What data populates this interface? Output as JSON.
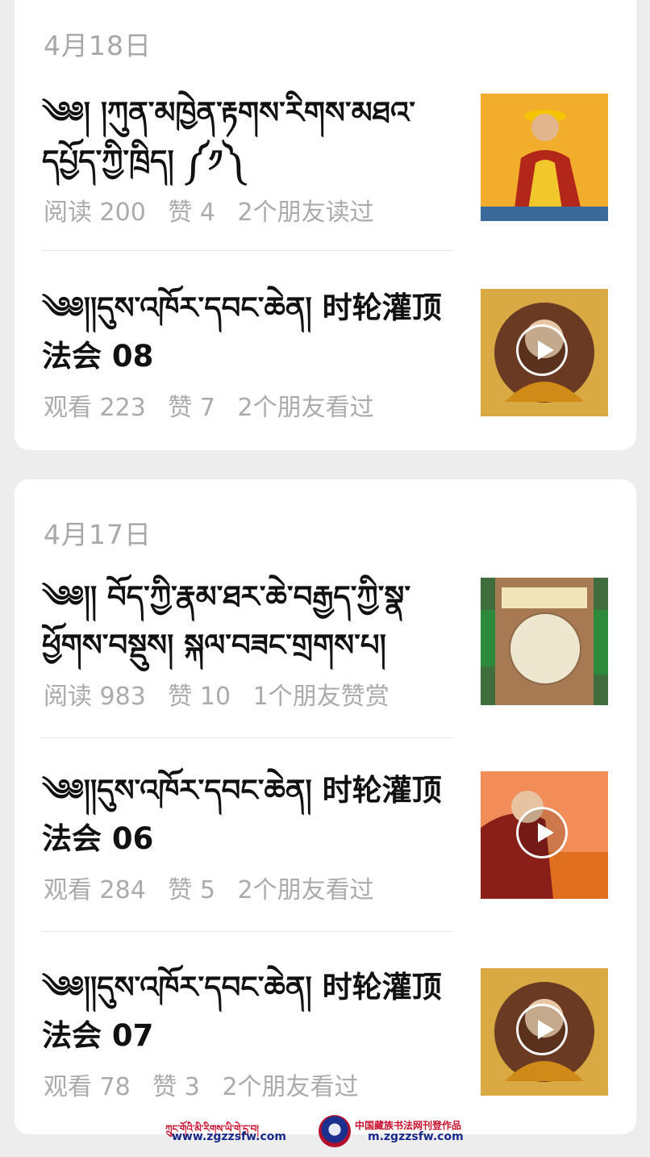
{
  "groups": [
    {
      "date": "4月18日",
      "items": [
        {
          "title": "༄༅། །ཀུན་མཁྱེན་རྟགས་རིགས་མཐའ་དཔྱོད་ཀྱི་ཁྲིད། ༼༡༽",
          "meta": [
            "阅读 200",
            "赞 4",
            "2个朋友读过"
          ],
          "thumb_icon": "portrait-thumbnail",
          "is_video": false
        },
        {
          "title": "༄༅།།དུས་འཁོར་དབང་ཆེན། 时轮灌顶法会 08",
          "meta": [
            "观看 223",
            "赞 7",
            "2个朋友看过"
          ],
          "thumb_icon": "video-thumbnail",
          "is_video": true
        }
      ]
    },
    {
      "date": "4月17日",
      "items": [
        {
          "title": "༄༅།། བོད་ཀྱི་རྣམ་ཐར་ཆེ་བརྒྱད་ཀྱི་སྣ་ཕྱོགས་བསྡུས། སྐལ་བཟང་གྲགས་པ།",
          "meta": [
            "阅读 983",
            "赞 10",
            "1个朋友赞赏"
          ],
          "thumb_icon": "book-cover-thumbnail",
          "is_video": false
        },
        {
          "title": "༄༅།།དུས་འཁོར་དབང་ཆེན། 时轮灌顶法会 06",
          "meta": [
            "观看 284",
            "赞 5",
            "2个朋友看过"
          ],
          "thumb_icon": "video-thumbnail",
          "is_video": true
        },
        {
          "title": "༄༅།།དུས་འཁོར་དབང་ཆེན། 时轮灌顶法会 07",
          "meta": [
            "观看 78",
            "赞 3",
            "2个朋友看过"
          ],
          "thumb_icon": "video-thumbnail",
          "is_video": true
        }
      ]
    }
  ],
  "footer": {
    "left_text": "ཀྲུང་གོའི་མི་རིགས་ཡི་གེ་དྲ་བ།",
    "right_text": "中国藏族书法网刊登作品",
    "url_left": "www.zgzzsfw.com",
    "url_right": "m.zgzzsfw.com"
  },
  "colors": {
    "background": "#ededed",
    "card": "#ffffff",
    "meta_text": "#ababab",
    "footer_red": "#c8102e",
    "footer_blue": "#1a2a8a"
  }
}
